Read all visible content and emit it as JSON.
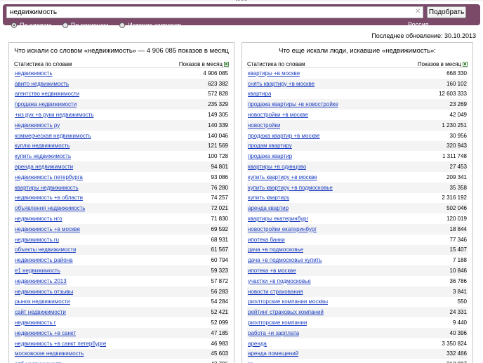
{
  "search": {
    "query": "недвижимость",
    "button": "Подобрать",
    "modes": [
      "По словам",
      "По регионам",
      "История запросов"
    ],
    "active_mode": 0,
    "region": "Россия"
  },
  "updated": "Последнее обновление: 30.10.2013",
  "left": {
    "title": "Что искали со словом «недвижимость» — 4 906 085 показов в месяц",
    "col_query": "Статистика по словам",
    "col_count": "Показов в месяц",
    "rows": [
      [
        "недвижимость",
        "4 906 085"
      ],
      [
        "авито недвижимость",
        "623 382"
      ],
      [
        "агентство недвижимости",
        "572 828"
      ],
      [
        "продажа недвижимости",
        "235 329"
      ],
      [
        "+из рук +в руки недвижимость",
        "149 305"
      ],
      [
        "недвижимость ру",
        "140 339"
      ],
      [
        "коммерческая недвижимость",
        "140 046"
      ],
      [
        "куплю недвижимость",
        "121 569"
      ],
      [
        "купить недвижимость",
        "100 728"
      ],
      [
        "аренда недвижимости",
        "94 801"
      ],
      [
        "недвижимость петербурга",
        "93 086"
      ],
      [
        "квартиры недвижимость",
        "76 280"
      ],
      [
        "недвижимость +в области",
        "74 257"
      ],
      [
        "объявления недвижимость",
        "72 021"
      ],
      [
        "недвижимость нго",
        "71 830"
      ],
      [
        "недвижимость +в москве",
        "69 592"
      ],
      [
        "недвижимость.ru",
        "68 931"
      ],
      [
        "объекты недвижимости",
        "61 567"
      ],
      [
        "недвижимость района",
        "60 794"
      ],
      [
        "е1 недвижимость",
        "59 323"
      ],
      [
        "недвижимость 2013",
        "57 872"
      ],
      [
        "недвижимость отзывы",
        "56 283"
      ],
      [
        "рынок недвижимости",
        "54 284"
      ],
      [
        "сайт недвижимости",
        "52 421"
      ],
      [
        "недвижимость г",
        "52 099"
      ],
      [
        "недвижимость +в санкт",
        "47 185"
      ],
      [
        "недвижимость +в санкт петербурге",
        "46 983"
      ],
      [
        "московская недвижимость",
        "45 603"
      ],
      [
        "опб недвижимость",
        "43 796"
      ]
    ]
  },
  "right": {
    "title": "Что еще искали люди, искавшие «недвижимость»:",
    "col_query": "Статистика по словам",
    "col_count": "Показов в месяц",
    "rows": [
      [
        "квартиры +в москве",
        "668 330"
      ],
      [
        "снять квартиру +в москве",
        "160 102"
      ],
      [
        "квартира",
        "12 603 333"
      ],
      [
        "продажа квартиры +в новостройке",
        "23 269"
      ],
      [
        "новостройки +в москве",
        "42 049"
      ],
      [
        "новостройки",
        "1 230 251"
      ],
      [
        "продажа квартир +в москве",
        "30 956"
      ],
      [
        "продам квартиру",
        "320 943"
      ],
      [
        "продажа квартир",
        "1 311 748"
      ],
      [
        "квартиры +в одинцово",
        "27 453"
      ],
      [
        "купить квартиру +в москве",
        "209 341"
      ],
      [
        "купить квартиру +в подмосковье",
        "35 358"
      ],
      [
        "купить квартиру",
        "2 316 192"
      ],
      [
        "аренда квартир",
        "502 046"
      ],
      [
        "квартиры екатеринбург",
        "120 019"
      ],
      [
        "новостройки екатеринбург",
        "18 844"
      ],
      [
        "ипотека банки",
        "77 346"
      ],
      [
        "дача +в подмосковье",
        "15 407"
      ],
      [
        "дача +в подмосковье купить",
        "7 188"
      ],
      [
        "ипотека +в москве",
        "10 846"
      ],
      [
        "участки +в подмосковье",
        "36 786"
      ],
      [
        "новости страхования",
        "3 841"
      ],
      [
        "риэлторские компании москвы",
        "550"
      ],
      [
        "рейтинг страховых компаний",
        "24 331"
      ],
      [
        "риэлторские компании",
        "9 440"
      ],
      [
        "работа +и зарплата",
        "40 396"
      ],
      [
        "аренда",
        "3 350 824"
      ],
      [
        "аренда помещений",
        "332 466"
      ],
      [
        "irr",
        "212 987"
      ]
    ]
  }
}
